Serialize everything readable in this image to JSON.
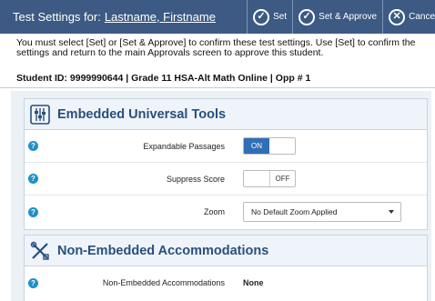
{
  "header": {
    "title_prefix": "Test Settings for:",
    "student_name": "Lastname, Firstname",
    "buttons": {
      "set": "Set",
      "set_approve": "Set & Approve",
      "cancel": "Cance"
    },
    "colors": {
      "bar": "#3c5a83"
    }
  },
  "instructions": "You must select [Set] or [Set & Approve] to confirm these test settings. Use [Set] to confirm the settings and return to the main Approvals screen to approve this student.",
  "student_line": "Student ID: 9999990644 | Grade 11 HSA-Alt Math Online | Opp # 1",
  "sections": {
    "embedded": {
      "title": "Embedded Universal Tools",
      "icon": "tools-grid-icon",
      "rows": {
        "expandable": {
          "label": "Expandable Passages",
          "state": "ON"
        },
        "suppress": {
          "label": "Suppress Score",
          "state": "OFF"
        },
        "zoom": {
          "label": "Zoom",
          "value": "No Default Zoom Applied"
        }
      }
    },
    "non_embedded": {
      "title": "Non-Embedded Accommodations",
      "icon": "wrench-ruler-icon",
      "rows": {
        "accommodations": {
          "label": "Non-Embedded Accommodations",
          "value": "None"
        }
      }
    }
  },
  "help_icon_glyph": "?"
}
